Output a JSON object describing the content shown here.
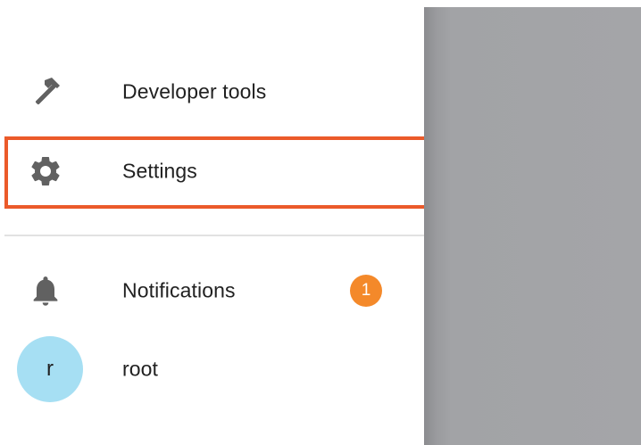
{
  "drawer": {
    "items": [
      {
        "label": "Developer tools",
        "icon": "hammer-icon"
      },
      {
        "label": "Settings",
        "icon": "gear-icon",
        "highlighted": true
      },
      {
        "label": "Notifications",
        "icon": "bell-icon",
        "badge": "1"
      }
    ],
    "user": {
      "avatar_initial": "r",
      "name": "root"
    }
  },
  "colors": {
    "highlight": "#eb5a2a",
    "badge": "#f4892a",
    "avatar": "#a6dff3",
    "icon": "#616161",
    "scrim": "#a4a5a8"
  }
}
